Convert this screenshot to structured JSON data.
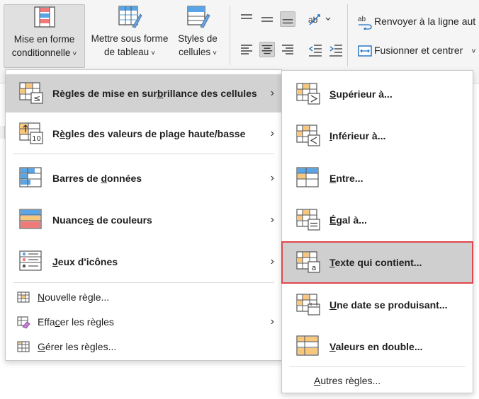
{
  "ribbon": {
    "conditional_format": {
      "line1": "Mise en forme",
      "line2": "conditionnelle"
    },
    "table_format": {
      "line1": "Mettre sous forme",
      "line2": "de tableau"
    },
    "cell_styles": {
      "line1": "Styles de",
      "line2": "cellules"
    },
    "wrap_text": "Renvoyer à la ligne aut",
    "merge_center": "Fusionner et centrer",
    "caret": "˅",
    "merge_caret": "˅"
  },
  "main_menu": {
    "items": [
      {
        "pre": "Règles de mise en sur",
        "u": "b",
        "post": "rillance des cellules",
        "arrow": "›"
      },
      {
        "pre": "R",
        "u": "è",
        "post": "gles des valeurs de plage haute/basse",
        "arrow": "›"
      },
      {
        "pre": "Barres de ",
        "u": "d",
        "post": "onnées",
        "arrow": "›"
      },
      {
        "pre": "Nuance",
        "u": "s",
        "post": " de couleurs",
        "arrow": "›"
      },
      {
        "pre": "",
        "u": "J",
        "post": "eux d'icônes",
        "arrow": "›"
      }
    ],
    "small_items": [
      {
        "pre": "",
        "u": "N",
        "post": "ouvelle règle..."
      },
      {
        "pre": "Effa",
        "u": "c",
        "post": "er les règles",
        "arrow": "›"
      },
      {
        "pre": "",
        "u": "G",
        "post": "érer les règles..."
      }
    ]
  },
  "sub_menu": {
    "items": [
      {
        "pre": "",
        "u": "S",
        "post": "upérieur à..."
      },
      {
        "pre": "",
        "u": "I",
        "post": "nférieur à..."
      },
      {
        "pre": "",
        "u": "E",
        "post": "ntre..."
      },
      {
        "pre": "",
        "u": "É",
        "post": "gal à..."
      },
      {
        "pre": "",
        "u": "T",
        "post": "exte qui contient..."
      },
      {
        "pre": "",
        "u": "U",
        "post": "ne date se produisant..."
      },
      {
        "pre": "",
        "u": "V",
        "post": "aleurs en double..."
      }
    ],
    "more": {
      "pre": "",
      "u": "A",
      "post": "utres règles..."
    }
  },
  "colors": {
    "accent_red": "#e0474c",
    "orange": "#f8c77e",
    "blue": "#5aa5e6",
    "red": "#f07a7a",
    "hover_bg": "#d2d2d2"
  }
}
